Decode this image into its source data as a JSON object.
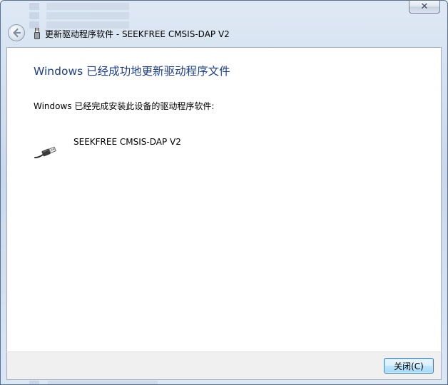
{
  "window": {
    "title": "更新驱动程序软件 - SEEKFREE CMSIS-DAP V2",
    "close_glyph": "✕"
  },
  "content": {
    "heading": "Windows 已经成功地更新驱动程序文件",
    "message": "Windows 已经完成安装此设备的驱动程序软件:",
    "device_name": "SEEKFREE CMSIS-DAP V2"
  },
  "footer": {
    "close_button_label": "关闭(C)"
  },
  "icons": {
    "back": "back-arrow-icon",
    "title": "usb-device-icon",
    "device": "usb-plug-icon",
    "close": "close-icon"
  },
  "colors": {
    "heading": "#1e3f8c",
    "glass": "#dfe9f5",
    "button_border": "#3c7fb1"
  }
}
